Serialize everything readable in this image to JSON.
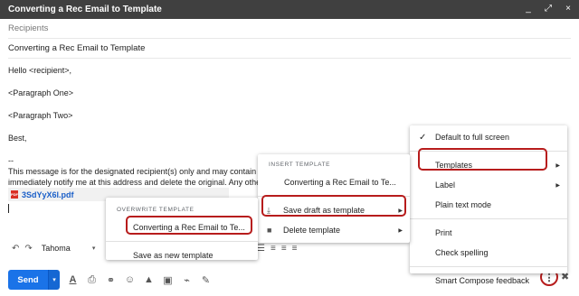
{
  "window": {
    "title": "Converting a Rec Email to Template",
    "controls": [
      "_",
      "⤢",
      "×"
    ]
  },
  "recipients_placeholder": "Recipients",
  "subject": "Converting a Rec Email to Template",
  "body": {
    "greeting": "Hello <recipient>,",
    "para1": "<Paragraph One>",
    "para2": "<Paragraph Two>",
    "closing": "Best,",
    "sig_sep": "--",
    "disclaimer1": "This message is for the designated recipient(s) only and may contain privi",
    "disclaimer2": "immediately notify me at this address and delete the original. Any other us"
  },
  "attachment": {
    "icon_label": "PDF",
    "filename": "3SdYyX6l.pdf"
  },
  "format_toolbar": {
    "undo": "↶",
    "redo": "↷",
    "font": "Tahoma",
    "font_arrow": "▾",
    "list_icons": [
      "☰",
      "≡",
      "≡",
      "≡"
    ]
  },
  "bottom_toolbar": {
    "send_label": "Send",
    "send_arrow": "▾",
    "icons": [
      "A",
      "⎙",
      "⚭",
      "☺",
      "▲",
      "▣",
      "⌁",
      "✎"
    ],
    "more": "⋮",
    "trash": "✖"
  },
  "main_menu": {
    "items": [
      {
        "label": "Default to full screen",
        "check": "✓"
      },
      {
        "label": "Templates",
        "arrow": "▶"
      },
      {
        "label": "Label",
        "arrow": "▶"
      },
      {
        "label": "Plain text mode"
      },
      {
        "label": "Print"
      },
      {
        "label": "Check spelling"
      },
      {
        "label": "Smart Compose feedback"
      }
    ]
  },
  "templates_menu": {
    "heading": "INSERT TEMPLATE",
    "insert_item": "Converting a Rec Email to Te...",
    "save_draft": "Save draft as template",
    "delete": "Delete template",
    "arrow": "▶",
    "save_icon": "⤓",
    "delete_icon": "■"
  },
  "overwrite_menu": {
    "heading": "OVERWRITE TEMPLATE",
    "item": "Converting a Rec Email to Te...",
    "save_new": "Save as new template"
  },
  "colors": {
    "accent": "#1a73e8",
    "highlight_outline": "#b71c1c",
    "titlebar": "#404040"
  }
}
